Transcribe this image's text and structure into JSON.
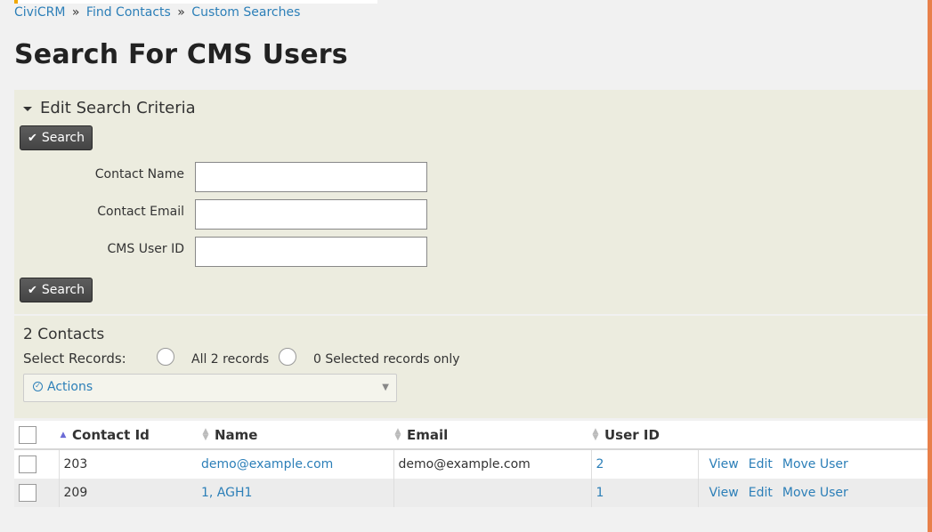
{
  "breadcrumb": {
    "items": [
      "CiviCRM",
      "Find Contacts",
      "Custom Searches"
    ],
    "separator": "»"
  },
  "page_title": "Search For CMS Users",
  "criteria": {
    "header": "Edit Search Criteria",
    "search_button": "Search",
    "fields": [
      {
        "label": "Contact Name",
        "value": ""
      },
      {
        "label": "Contact Email",
        "value": ""
      },
      {
        "label": "CMS User ID",
        "value": ""
      }
    ]
  },
  "results": {
    "count_label": "2 Contacts",
    "select_records_label": "Select Records:",
    "option_all": "All 2 records",
    "option_selected": "0 Selected records only",
    "actions_label": "Actions"
  },
  "table": {
    "columns": [
      "Contact Id",
      "Name",
      "Email",
      "User ID"
    ],
    "rows": [
      {
        "contact_id": "203",
        "name": "demo@example.com",
        "email": "demo@example.com",
        "user_id": "2",
        "links": [
          "View",
          "Edit",
          "Move User"
        ]
      },
      {
        "contact_id": "209",
        "name": "1, AGH1",
        "email": "",
        "user_id": "1",
        "links": [
          "View",
          "Edit",
          "Move User"
        ]
      }
    ]
  },
  "colors": {
    "link": "#2c7fb8",
    "panel_bg": "#ececdf",
    "button_bg": "#4f4f4f",
    "accent_orange": "#e8804a"
  }
}
